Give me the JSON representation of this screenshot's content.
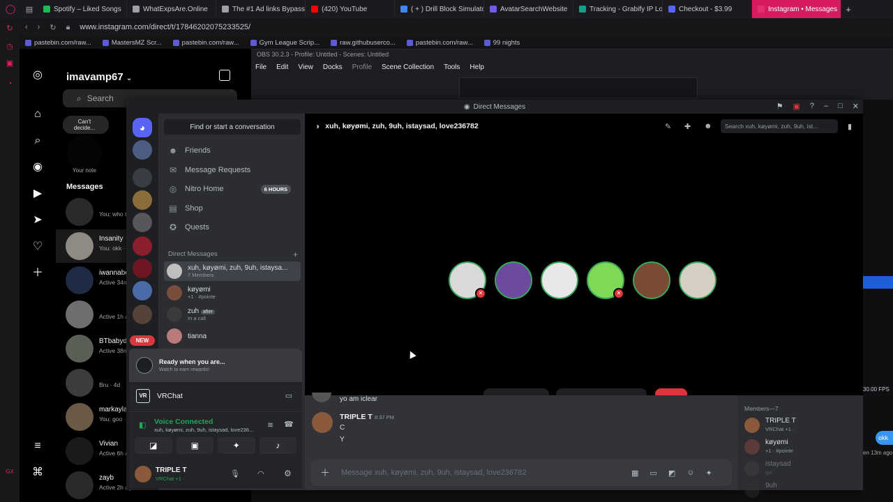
{
  "browser": {
    "tabs": [
      {
        "label": "Spotify – Liked Songs",
        "color": "#1db954"
      },
      {
        "label": "WhatExpsAre.Online",
        "color": "#9aa0a6"
      },
      {
        "label": "The #1 Ad links Bypasser",
        "color": "#9aa0a6"
      },
      {
        "label": "(420) YouTube",
        "color": "#ff0000"
      },
      {
        "label": "( + ) Drill Block Simulator",
        "color": "#4285f4"
      },
      {
        "label": "AvatarSearchWebsite",
        "color": "#6c5ce7"
      },
      {
        "label": "Tracking - Grabify IP Logger",
        "color": "#16a085"
      },
      {
        "label": "Checkout - $3.99",
        "color": "#5865f2"
      },
      {
        "label": "Instagram • Messages",
        "color": "#e1306c",
        "active": true
      }
    ],
    "new_tab": "+",
    "url": "www.instagram.com/direct/t/17846202075233525/",
    "bookmarks": [
      "pastebin.com/raw...",
      "MastersMZ Scr...",
      "pastebin.com/raw...",
      "Gym League Scrip...",
      "raw.githubuserco...",
      "pastebin.com/raw...",
      "99 nights"
    ]
  },
  "instagram": {
    "username": "imavamp67",
    "search_placeholder": "Search",
    "note_bubble": "Can't decide...",
    "note_label": "Your note",
    "messages_heading": "Messages",
    "conversations": [
      {
        "name": "",
        "sub": "You: who t..."
      },
      {
        "name": "Insanity",
        "sub": "You: okk ·"
      },
      {
        "name": "iwannabe",
        "sub": "Active 34m"
      },
      {
        "name": "",
        "sub": "Active 1h a..."
      },
      {
        "name": "BTbabyd",
        "sub": "Active 38m"
      },
      {
        "name": "",
        "sub": "Bru · 4d"
      },
      {
        "name": "markayla",
        "sub": "You: goo ·"
      },
      {
        "name": "Vivian",
        "sub": "Active 6h a..."
      },
      {
        "name": "zayb",
        "sub": "Active 2h ago"
      }
    ]
  },
  "obs": {
    "title": "OBS 30.2.3 - Profile: Untitled - Scenes: Untitled",
    "menu": [
      "File",
      "Edit",
      "View",
      "Docks",
      "Profile",
      "Scene Collection",
      "Tools",
      "Help"
    ]
  },
  "discord": {
    "window_title": "Direct Messages",
    "find_label": "Find or start a conversation",
    "nav": [
      {
        "label": "Friends",
        "icon": "friends-icon"
      },
      {
        "label": "Message Requests",
        "icon": "mail-icon"
      },
      {
        "label": "Nitro Home",
        "icon": "nitro-icon",
        "badge": "6 HOURS"
      },
      {
        "label": "Shop",
        "icon": "shop-icon"
      },
      {
        "label": "Quests",
        "icon": "quests-icon"
      }
    ],
    "dm_heading": "Direct Messages",
    "dm_add": "+",
    "dms": [
      {
        "name": "xuh, køyømi, zuh, 9uh, istaysa...",
        "sub": "7 Members"
      },
      {
        "name": "køyømi",
        "sub": "+1 · #pointe"
      },
      {
        "name": "zuh",
        "tag": "after",
        "sub": "In a call"
      },
      {
        "name": "tianna",
        "sub": ""
      }
    ],
    "guild_new_badge": "NEW",
    "popup_title": "Ready when you are...",
    "popup_sub": "Watch to earn rewards!",
    "activity": "VRChat",
    "voice_status": "Voice Connected",
    "voice_channel": "xuh, køyømi, zuh, 9uh, istaysad, love236...",
    "user_name": "TRIPLE T",
    "user_status": "VRChat +1 ·",
    "channel_name": "xuh, køyømi, zuh, 9uh, istaysad, love236782",
    "search_placeholder": "Search xuh, køyømi, zuh, 9uh, ist...",
    "call_participants": 6,
    "messages": [
      {
        "author": "",
        "text": "yo am iclear"
      },
      {
        "author": "TRIPLE T",
        "time": "8:37 PM",
        "lines": [
          "C",
          "Y"
        ]
      }
    ],
    "message_placeholder": "Message xuh, køyømi, zuh, 9uh, istaysad, love236782",
    "members_heading": "Members—7",
    "members": [
      {
        "name": "TRIPLE T",
        "sub": "VRChat +1 ·"
      },
      {
        "name": "køyømi",
        "sub": "+1 · #pointe"
      },
      {
        "name": "istaysad",
        "sub": "iyu"
      },
      {
        "name": "9uh",
        "sub": ""
      }
    ],
    "colors": {
      "accent": "#5865f2",
      "danger": "#da373c",
      "online": "#23a55a"
    }
  },
  "misc": {
    "fps": "30.00 FPS",
    "ig_reply_btn": "okk",
    "ig_time": "en 13m ago"
  }
}
